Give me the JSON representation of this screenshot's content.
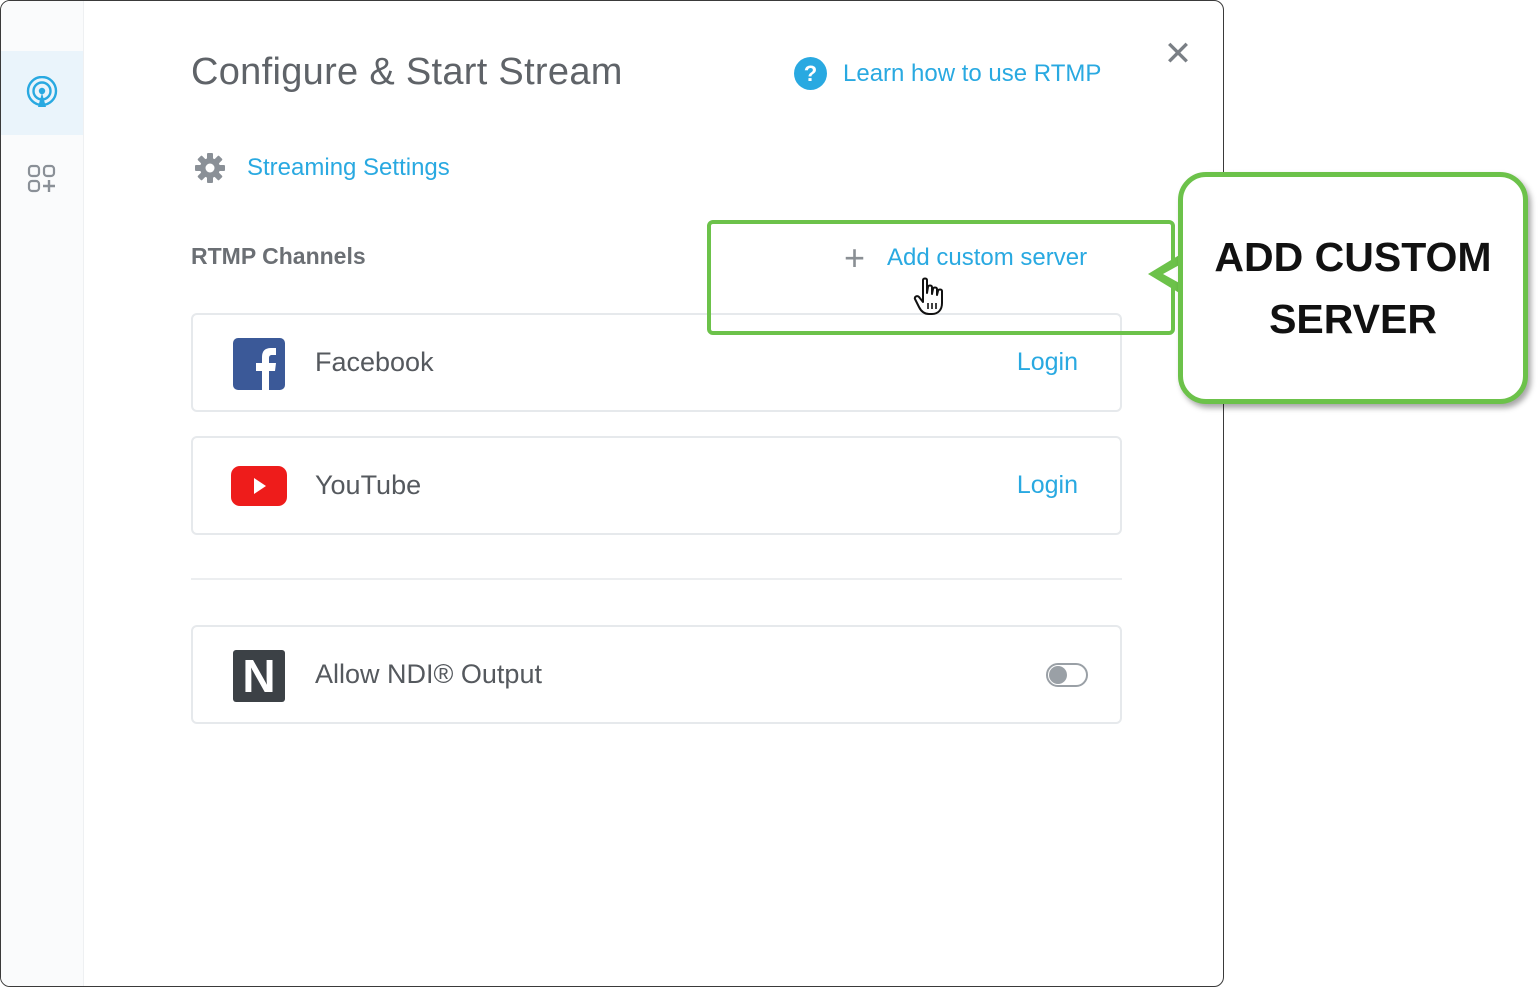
{
  "dialog": {
    "title": "Configure & Start Stream",
    "help_link": "Learn how to use RTMP",
    "close_glyph": "✕"
  },
  "rail": {
    "items": [
      {
        "icon": "broadcast-icon",
        "active": true
      },
      {
        "icon": "apps-add-icon",
        "active": false
      }
    ]
  },
  "settings": {
    "label": "Streaming Settings",
    "icon": "gear-icon"
  },
  "rtmp": {
    "section_label": "RTMP Channels",
    "add_label": "Add custom server",
    "add_glyph": "+",
    "channels": [
      {
        "name": "Facebook",
        "action": "Login",
        "icon": "facebook-icon"
      },
      {
        "name": "YouTube",
        "action": "Login",
        "icon": "youtube-icon"
      }
    ]
  },
  "ndi": {
    "label": "Allow NDI® Output",
    "logo_letter": "N",
    "enabled": false
  },
  "callout": {
    "line1": "ADD CUSTOM",
    "line2": "SERVER"
  },
  "colors": {
    "accent": "#29a9e1",
    "highlight": "#6cc24a",
    "facebook": "#3b5998",
    "youtube": "#ee1c1b",
    "ndi": "#3c4146"
  }
}
